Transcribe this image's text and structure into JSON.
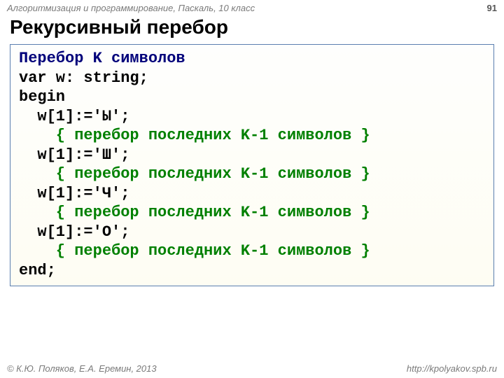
{
  "header": {
    "course": "Алгоритмизация и программирование, Паскаль, 10 класс",
    "page": "91"
  },
  "title": "Рекурсивный перебор",
  "code": {
    "l1_navy": "Перебор K символов",
    "l2_a": "var",
    "l2_b": " w: ",
    "l2_c": "string",
    "l2_d": ";",
    "l3": "begin",
    "l4": "  w[1]:='Ы';",
    "l5": "    { перебор последних K-1 символов }",
    "l6": "  w[1]:='Ш';",
    "l7": "    { перебор последних K-1 символов }",
    "l8": "  w[1]:='Ч';",
    "l9": "    { перебор последних K-1 символов }",
    "l10": "  w[1]:='О';",
    "l11": "    { перебор последних K-1 символов }",
    "l12": "end",
    "l12b": ";"
  },
  "footer": {
    "copyright": "© К.Ю. Поляков, Е.А. Еремин, 2013",
    "url": "http://kpolyakov.spb.ru"
  }
}
